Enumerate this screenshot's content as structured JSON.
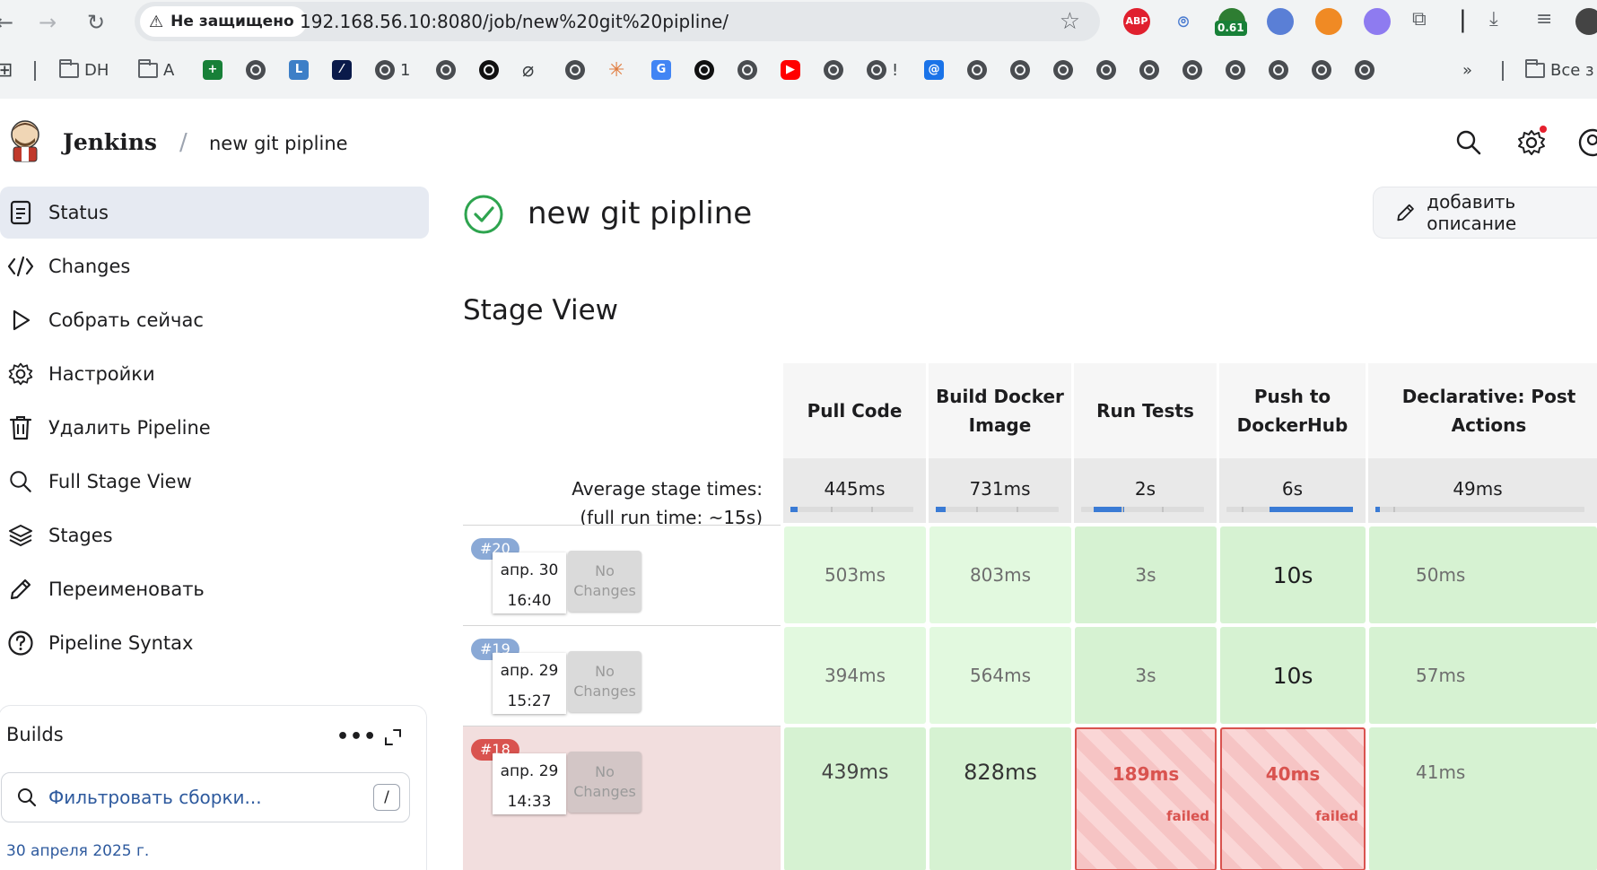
{
  "browser": {
    "security_label": "Не защищено",
    "url": "192.168.56.10:8080/job/new%20git%20pipline/",
    "extensions": [
      {
        "name": "abp",
        "label": "ABP",
        "color": "#e0202e"
      },
      {
        "name": "coin",
        "badge": "0.61",
        "color": "#188038"
      }
    ],
    "bookmarks": [
      {
        "label": "DH"
      },
      {
        "label": "A"
      },
      {
        "label": "1"
      },
      {
        "label": "!"
      },
      {
        "label": "Все з"
      }
    ]
  },
  "header": {
    "brand": "Jenkins",
    "breadcrumb": "new git pipline"
  },
  "sidebar": {
    "items": [
      {
        "label": "Status",
        "icon": "document-icon",
        "active": true
      },
      {
        "label": "Changes",
        "icon": "code-icon"
      },
      {
        "label": "Собрать сейчас",
        "icon": "play-icon"
      },
      {
        "label": "Настройки",
        "icon": "gear-icon"
      },
      {
        "label": "Удалить Pipeline",
        "icon": "trash-icon"
      },
      {
        "label": "Full Stage View",
        "icon": "search-icon"
      },
      {
        "label": "Stages",
        "icon": "layers-icon"
      },
      {
        "label": "Переименовать",
        "icon": "pencil-icon"
      },
      {
        "label": "Pipeline Syntax",
        "icon": "help-icon"
      }
    ]
  },
  "builds": {
    "title": "Builds",
    "more_label": "•••",
    "filter_placeholder": "Фильтровать сборки...",
    "filter_shortcut": "/",
    "date_group": "30 апреля 2025 г."
  },
  "main": {
    "title": "new git pipline",
    "add_description": "добавить описание",
    "stage_view_title": "Stage View"
  },
  "stage_view": {
    "avg_label_line1": "Average stage times:",
    "avg_label_full": "full",
    "avg_label_rest": " run time: ~15s)",
    "avg_label_open": "(",
    "stages": [
      {
        "name": "Pull Code",
        "avg": "445ms",
        "avg_fraction": 0.06
      },
      {
        "name": "Build Docker Image",
        "avg": "731ms",
        "avg_fraction": 0.08
      },
      {
        "name": "Run Tests",
        "avg": "2s",
        "avg_fraction": 0.25
      },
      {
        "name": "Push to DockerHub",
        "avg": "6s",
        "avg_fraction": 0.66
      },
      {
        "name": "Declarative: Post Actions",
        "avg": "49ms",
        "avg_fraction": 0.02
      }
    ],
    "runs": [
      {
        "id": "#20",
        "date": "апр. 30",
        "time": "16:40",
        "changes": "No Changes",
        "status": "success",
        "durations": [
          "503ms",
          "803ms",
          "3s",
          "10s",
          "50ms"
        ],
        "states": [
          "ok",
          "ok",
          "ok",
          "ok",
          "ok"
        ]
      },
      {
        "id": "#19",
        "date": "апр. 29",
        "time": "15:27",
        "changes": "No Changes",
        "status": "success",
        "durations": [
          "394ms",
          "564ms",
          "3s",
          "10s",
          "57ms"
        ],
        "states": [
          "ok",
          "ok",
          "ok",
          "ok",
          "ok"
        ]
      },
      {
        "id": "#18",
        "date": "апр. 29",
        "time": "14:33",
        "changes": "No Changes",
        "status": "failed",
        "durations": [
          "439ms",
          "828ms",
          "189ms",
          "40ms",
          "41ms"
        ],
        "states": [
          "ok",
          "ok",
          "fail",
          "fail",
          "ok"
        ],
        "failed_label": "failed"
      }
    ]
  },
  "colors": {
    "success_green": "#2ea44f",
    "failure_red": "#d9534f",
    "badge_blue": "#8aa9d6",
    "badge_red": "#d9534f"
  }
}
